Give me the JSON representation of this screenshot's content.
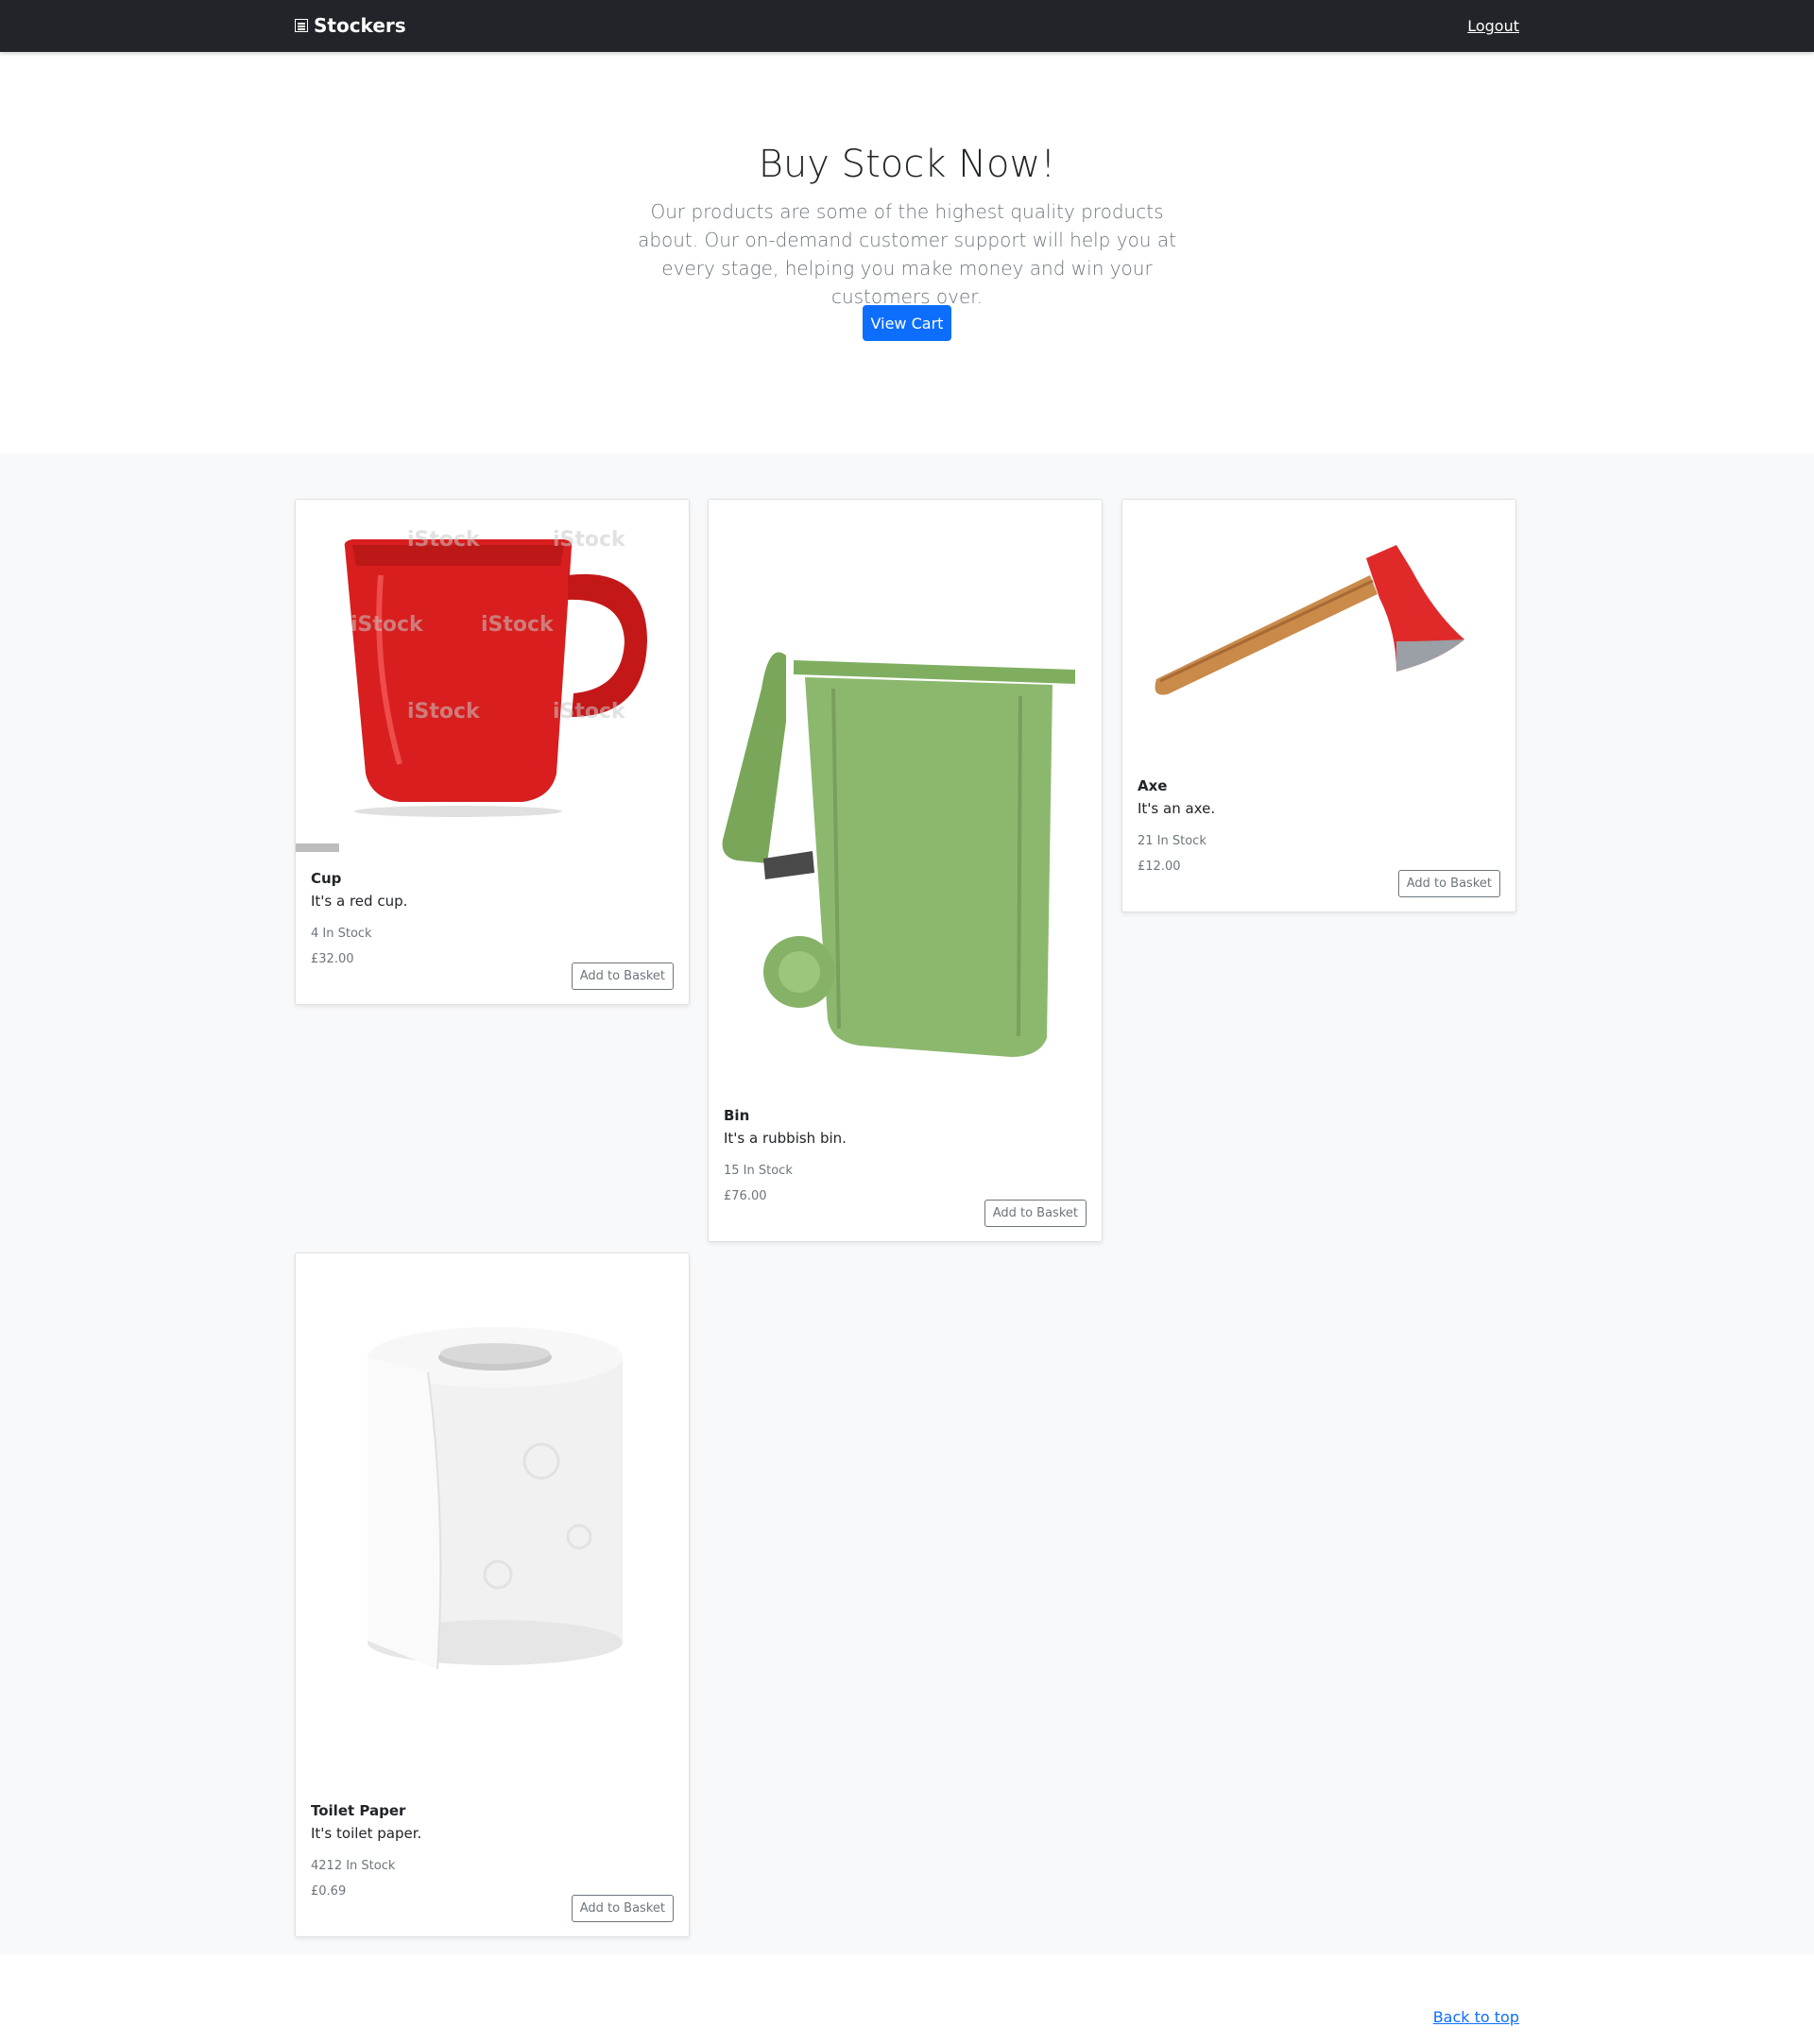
{
  "nav": {
    "brand": "Stockers",
    "logout": "Logout"
  },
  "hero": {
    "title": "Buy Stock Now!",
    "lead": "Our products are some of the highest quality products about. Our on-demand customer support will help you at every stage, helping you make money and win your customers over.",
    "cta": "View Cart"
  },
  "products": [
    {
      "name": "Cup",
      "description": "It's a red cup.",
      "stock": "4 In Stock",
      "price": "£32.00",
      "button": "Add to Basket"
    },
    {
      "name": "Bin",
      "description": "It's a rubbish bin.",
      "stock": "15 In Stock",
      "price": "£76.00",
      "button": "Add to Basket"
    },
    {
      "name": "Axe",
      "description": "It's an axe.",
      "stock": "21 In Stock",
      "price": "£12.00",
      "button": "Add to Basket"
    },
    {
      "name": "Toilet Paper",
      "description": "It's toilet paper.",
      "stock": "4212 In Stock",
      "price": "£0.69",
      "button": "Add to Basket"
    }
  ],
  "watermark": "iStock",
  "footer": {
    "back_to_top": "Back to top"
  },
  "colors": {
    "navbar": "#212529",
    "primary": "#0d6efd",
    "album_bg": "#f8f9fa"
  }
}
